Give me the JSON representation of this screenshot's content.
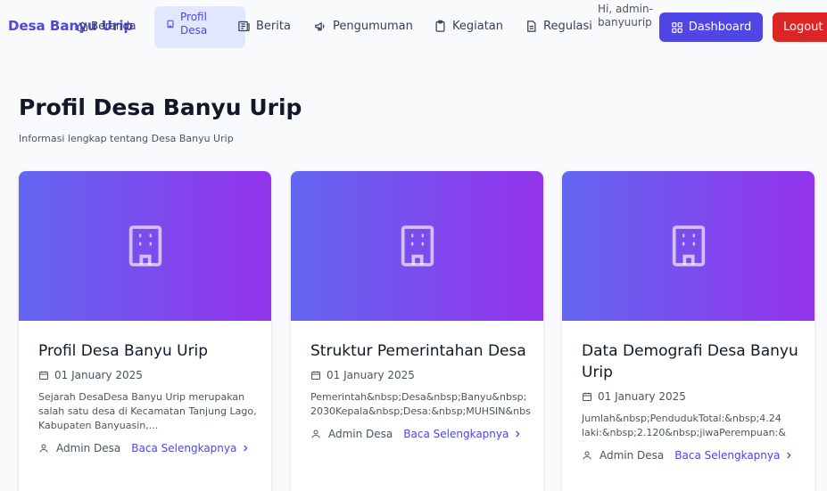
{
  "nav": {
    "brand": "Desa Banyu Urip",
    "brand_overlay": "Beranda",
    "active_item": "Profil Desa",
    "items": [
      {
        "label": "Berita",
        "icon": "newspaper-icon"
      },
      {
        "label": "Pengumuman",
        "icon": "megaphone-icon"
      },
      {
        "label": "Kegiatan",
        "icon": "clipboard-icon"
      },
      {
        "label": "Regulasi",
        "icon": "document-icon"
      }
    ],
    "greeting": "Hi, admin-banyuurip",
    "dashboard_label": "Dashboard",
    "logout_label": "Logout"
  },
  "header": {
    "title": "Profil Desa Banyu Urip",
    "subtitle": "Informasi lengkap tentang Desa Banyu Urip"
  },
  "cards": [
    {
      "title": "Profil Desa Banyu Urip",
      "date": "01 January 2025",
      "excerpt": "Sejarah DesaDesa Banyu Urip merupakan salah satu desa di Kecamatan Tanjung Lago, Kabupaten Banyuasin,...",
      "author": "Admin Desa",
      "link": "Baca Selengkapnya"
    },
    {
      "title": "Struktur Pemerintahan Desa",
      "date": "01 January 2025",
      "excerpt_lines": [
        "Pemerintah&nbsp;Desa&nbsp;Banyu&nbsp;",
        "2030Kepala&nbsp;Desa:&nbsp;MUHSIN&nbsp;"
      ],
      "author": "Admin Desa",
      "link": "Baca Selengkapnya"
    },
    {
      "title": "Data Demografi Desa Banyu Urip",
      "date": "01 January 2025",
      "excerpt_lines": [
        "Jumlah&nbsp;PendudukTotal:&nbsp;4.24",
        "laki:&nbsp;2.120&nbsp;jiwaPerempuan:&"
      ],
      "author": "Admin Desa",
      "link": "Baca Selengkapnya"
    }
  ],
  "colors": {
    "accent": "#4f46e5",
    "danger": "#dc2626",
    "hero_start": "#6366f1",
    "hero_end": "#9333ea"
  }
}
